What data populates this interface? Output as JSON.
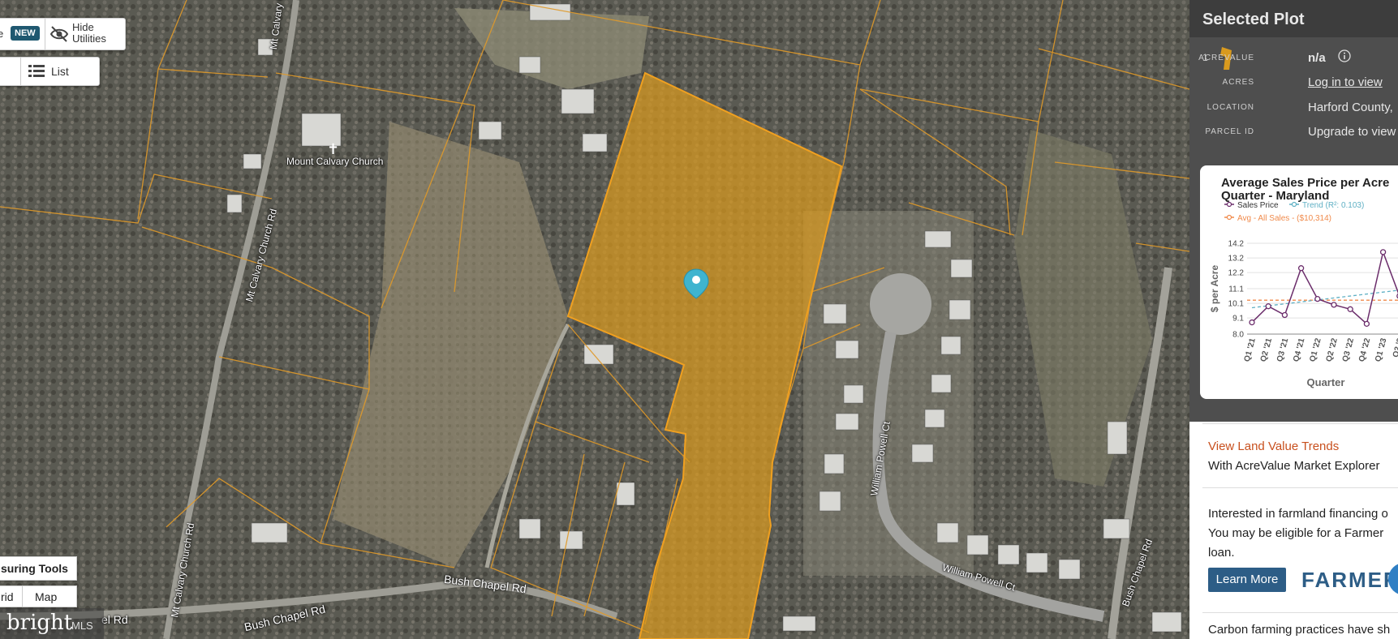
{
  "map": {
    "controls": {
      "new_badge": "NEW",
      "hide_utilities": [
        "Hide",
        "Utilities"
      ],
      "list_label": "List",
      "measuring_tools": "suring Tools",
      "grid_label": "rid",
      "map_label": "Map",
      "logo_text": "bright",
      "logo_suffix": "MLS"
    },
    "labels": {
      "church": "Mount Calvary Church",
      "road1": "Mt Calvary Church Rd",
      "road2": "Mt Calvary Church Rd",
      "road3": "Mt Calvary Church Rd",
      "bush1": "Bush Chapel Rd",
      "bush2": "Bush Chapel Rd",
      "bush3": "el Rd",
      "bush4": "Bush Chapel Rd",
      "powell1": "William Powell Ct",
      "powell2": "William Powell Ct"
    }
  },
  "panel": {
    "title": "Selected Plot",
    "row_number": "1",
    "fields": [
      {
        "label": "ACREVALUE",
        "value": "n/a"
      },
      {
        "label": "ACRES",
        "value": "Log in to view"
      },
      {
        "label": "LOCATION",
        "value": "Harford County,"
      },
      {
        "label": "PARCEL ID",
        "value": "Upgrade to view"
      }
    ],
    "trends_link": "View Land Value Trends",
    "trends_sub": "With AcreValue Market Explorer",
    "finance_text": [
      "Interested in farmland financing o",
      "You may be eligible for a Farmer",
      "loan."
    ],
    "learn_more": "Learn More",
    "farmer_logo": "FARMER",
    "carbon_text": "Carbon farming practices have sh"
  },
  "chart_data": {
    "type": "line",
    "title": [
      "Average Sales Price per Acre",
      "Quarter - Maryland"
    ],
    "ylabel": "$ per Acre",
    "xlabel": "Quarter",
    "legend": [
      {
        "name": "Sales Price",
        "color": "#6b2d6b"
      },
      {
        "name": "Trend (R²: 0.103)",
        "color": "#5fb0c4"
      },
      {
        "name": "Avg - All Sales - ($10,314)",
        "color": "#f08a4b"
      }
    ],
    "categories": [
      "Q1 '21",
      "Q2 '21",
      "Q3 '21",
      "Q4 '21",
      "Q1 '22",
      "Q2 '22",
      "Q3 '22",
      "Q4 '22",
      "Q1 '23",
      "Q2 '2"
    ],
    "series": [
      {
        "name": "Sales Price",
        "values": [
          8.8,
          9.9,
          9.3,
          12.5,
          10.4,
          10.0,
          9.7,
          8.7,
          13.6,
          10.6
        ]
      }
    ],
    "ytick_labels": [
      "8.0",
      "9.1",
      "10.1",
      "11.1",
      "12.2",
      "13.2",
      "14.2"
    ],
    "ylim": [
      8.0,
      14.2
    ],
    "average": 10.314,
    "trend": [
      9.8,
      11.0
    ],
    "colors": {
      "series": "#6b2d6b",
      "trend": "#5fb0c4",
      "avg": "#f08a4b"
    }
  },
  "colors": {
    "parcel_fill": "#d99a1e",
    "parcel_line": "#f0a020",
    "link_orange": "#c8501e",
    "button_blue": "#2d5d86",
    "badge": "#1f5870",
    "marker": "#3fb4cf"
  }
}
